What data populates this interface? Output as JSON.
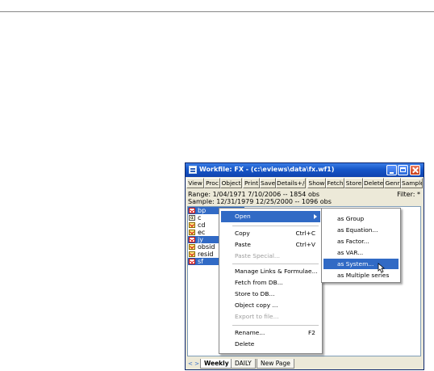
{
  "window": {
    "title": "Workfile: FX - (c:\\eviews\\data\\fx.wf1)",
    "toolbar": [
      "View",
      "Proc",
      "Object",
      "Print",
      "Save",
      "Details+/-",
      "Show",
      "Fetch",
      "Store",
      "Delete",
      "Genr",
      "Sample"
    ],
    "range_line": "Range:  1/04/1971 7/10/2006  --  1854 obs",
    "sample_line": "Sample: 12/31/1979 12/25/2000  --  1096 obs",
    "filter_label": "Filter: *"
  },
  "objects": [
    {
      "name": "bp",
      "icon": "series-icon",
      "selected": true
    },
    {
      "name": "c",
      "icon": "coefficient-icon",
      "selected": false
    },
    {
      "name": "cd",
      "icon": "series-icon",
      "selected": false
    },
    {
      "name": "ec",
      "icon": "series-icon",
      "selected": false
    },
    {
      "name": "jy",
      "icon": "series-icon",
      "selected": true
    },
    {
      "name": "obsid",
      "icon": "series-icon",
      "selected": false
    },
    {
      "name": "resid",
      "icon": "series-icon",
      "selected": false
    },
    {
      "name": "sf",
      "icon": "series-icon-red",
      "selected": true
    }
  ],
  "tabs": {
    "nav_arrows": "< >",
    "items": [
      "Weekly",
      "DAILY",
      "New Page"
    ],
    "active": "Weekly"
  },
  "context_menu": {
    "open": {
      "label": "Open"
    },
    "copy": {
      "label": "Copy",
      "shortcut": "Ctrl+C"
    },
    "paste": {
      "label": "Paste",
      "shortcut": "Ctrl+V"
    },
    "paste_special": {
      "label": "Paste Special..."
    },
    "manage_links": {
      "label": "Manage Links & Formulae..."
    },
    "fetch_db": {
      "label": "Fetch from DB..."
    },
    "store_db": {
      "label": "Store to DB..."
    },
    "object_copy": {
      "label": "Object copy ..."
    },
    "export": {
      "label": "Export to file..."
    },
    "rename": {
      "label": "Rename...",
      "shortcut": "F2"
    },
    "delete": {
      "label": "Delete"
    }
  },
  "open_submenu": [
    "as Group",
    "as Equation...",
    "as Factor...",
    "as VAR...",
    "as System...",
    "as Multiple series"
  ],
  "colors": {
    "selection": "#316ac5",
    "titlebar": "#1656c8",
    "chrome": "#ece9d8"
  }
}
